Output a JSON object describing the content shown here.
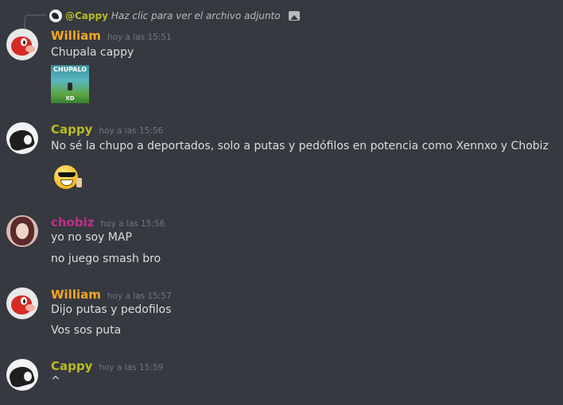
{
  "reply": {
    "author": "@Cappy",
    "text": "Haz clic para ver el archivo adjunto",
    "icon": "image-icon"
  },
  "messages": [
    {
      "author": "William",
      "author_color": "#f5a623",
      "timestamp": "hoy a las 15:51",
      "lines": [
        "Chupala cappy"
      ],
      "attachment": {
        "text_top": "CHUPALO",
        "text_bottom": "XD"
      }
    },
    {
      "author": "Cappy",
      "author_color": "#b9bb25",
      "timestamp": "hoy a las 15:56",
      "lines": [
        "No sé la chupo a deportados, solo a putas y pedófilos en potencia como Xennxo y Chobiz"
      ],
      "emoji": "sunglasses-thumbsup-emoji"
    },
    {
      "author": "chobiz",
      "author_color": "#c0308c",
      "timestamp": "hoy a las 15:56",
      "lines": [
        "yo no soy MAP",
        "no juego smash bro"
      ]
    },
    {
      "author": "William",
      "author_color": "#f5a623",
      "timestamp": "hoy a las 15:57",
      "lines": [
        "Dijo putas y pedofilos",
        "Vos sos puta"
      ]
    },
    {
      "author": "Cappy",
      "author_color": "#b9bb25",
      "timestamp": "hoy a las 15:59",
      "lines": [
        "^"
      ]
    }
  ]
}
